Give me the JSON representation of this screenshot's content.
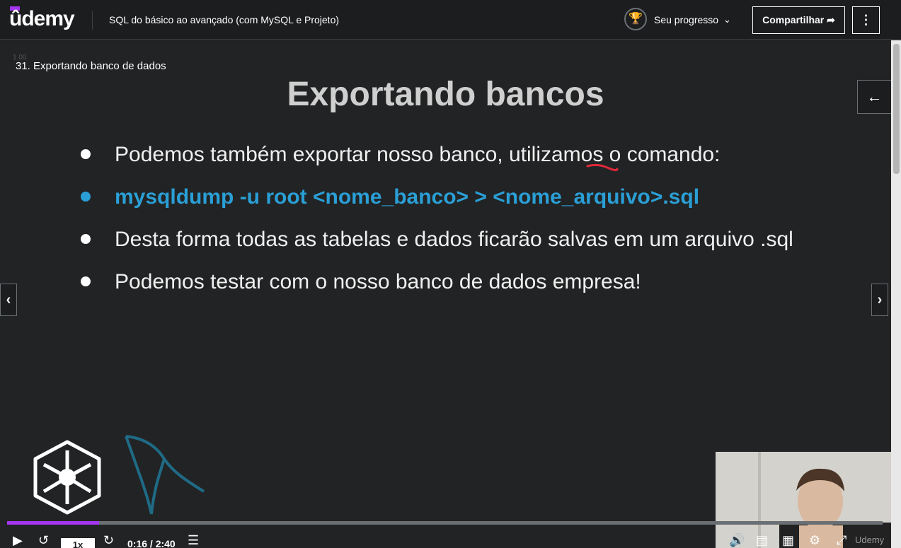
{
  "header": {
    "logo": "ûdemy",
    "course_title": "SQL do básico ao avançado (com MySQL e Projeto)",
    "progress_label": "Seu progresso",
    "share_label": "Compartilhar"
  },
  "player": {
    "lecture_title": "31. Exportando banco de dados",
    "rate_ghost": "1.00",
    "speed": "1x",
    "time": "0:16 / 2:40",
    "progress": 0.105,
    "watermark": "Udemy"
  },
  "slide": {
    "title": "Exportando bancos",
    "bullets": [
      "Podemos também exportar nosso banco, utilizamos o comando:",
      "mysqldump -u root <nome_banco> > <nome_arquivo>.sql",
      "Desta forma todas as tabelas e dados ficarão salvas em um arquivo .sql",
      "Podemos testar com o nosso banco de dados empresa!"
    ]
  },
  "colors": {
    "accent": "#a435f0",
    "command": "#2a9fd6",
    "background": "#1c1d1f"
  },
  "icons": [
    "trophy-icon",
    "chevron-down-icon",
    "share-arrow-icon",
    "more-vertical-icon",
    "arrow-left-icon",
    "chevron-left-icon",
    "chevron-right-icon",
    "play-icon",
    "rewind-icon",
    "forward-icon",
    "notes-icon",
    "volume-icon",
    "transcript-icon",
    "captions-icon",
    "settings-icon",
    "fullscreen-icon",
    "expand-icon"
  ]
}
